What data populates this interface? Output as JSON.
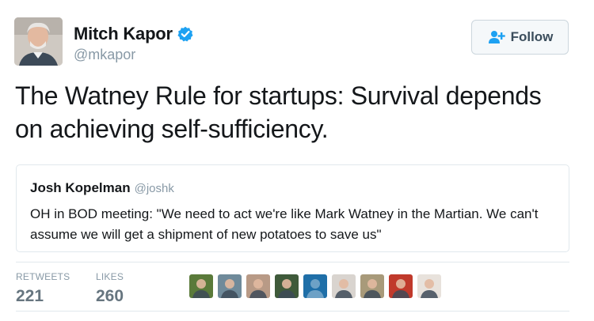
{
  "author": {
    "name": "Mitch Kapor",
    "handle": "@mkapor",
    "verified": true,
    "avatar_icon": "person-photo-icon"
  },
  "follow_button": {
    "label": "Follow",
    "icon": "add-user-icon"
  },
  "tweet": {
    "text": "The Watney Rule for startups: Survival depends on achieving self-sufficiency."
  },
  "quoted_tweet": {
    "name": "Josh Kopelman",
    "handle": "@joshk",
    "text": "OH in BOD meeting: \"We need to act we're like Mark Watney in the Martian. We can't assume we will get a shipment of new potatoes to save us\""
  },
  "stats": {
    "retweets": {
      "label": "RETWEETS",
      "value": "221"
    },
    "likes": {
      "label": "LIKES",
      "value": "260"
    }
  },
  "likers": [
    {
      "icon": "liker-avatar-icon",
      "color": "#5a7a3a"
    },
    {
      "icon": "liker-avatar-icon",
      "color": "#6f8a9a"
    },
    {
      "icon": "liker-avatar-icon",
      "color": "#b89a86"
    },
    {
      "icon": "liker-avatar-icon",
      "color": "#3f5a3a"
    },
    {
      "icon": "liker-avatar-icon",
      "color": "#1f6fa8"
    },
    {
      "icon": "liker-avatar-icon",
      "color": "#d9d4cf"
    },
    {
      "icon": "liker-avatar-icon",
      "color": "#a89a7a"
    },
    {
      "icon": "liker-avatar-icon",
      "color": "#c0392b"
    },
    {
      "icon": "liker-avatar-icon",
      "color": "#e8e2dc"
    }
  ],
  "colors": {
    "text": "#14171a",
    "muted": "#8899a6",
    "border": "#e1e8ed",
    "verified": "#1da1f2"
  }
}
